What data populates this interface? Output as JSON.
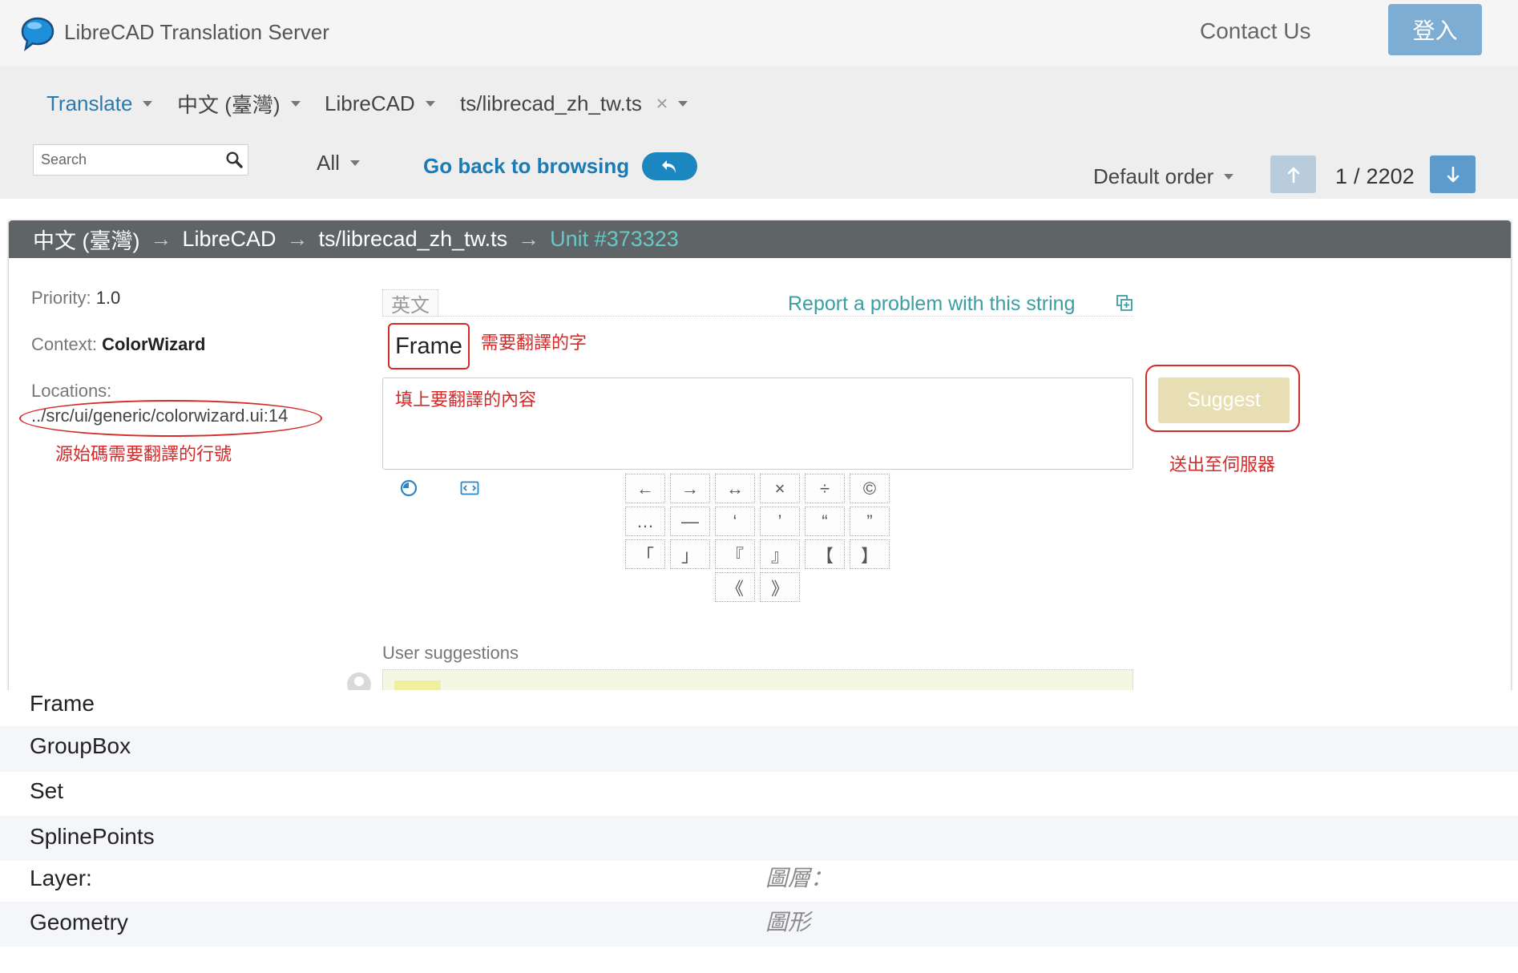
{
  "colors": {
    "brand_blue": "#1b7bb5",
    "header_bar": "#5f6566",
    "unit_teal": "#69c7c7",
    "report_teal": "#3b9ea2",
    "annotation_red": "#d42a2a",
    "suggest_button": "#e7dfb3",
    "login_button": "#7eadd3"
  },
  "header": {
    "logo_icon": "speech-bubble-icon",
    "title": "LibreCAD Translation Server",
    "contact": "Contact Us",
    "login": "登入"
  },
  "nav": {
    "breadcrumb": {
      "translate": "Translate",
      "language": "中文 (臺灣)",
      "project": "LibreCAD",
      "file": "ts/librecad_zh_tw.ts"
    },
    "search": {
      "placeholder": "Search"
    },
    "filter": "All",
    "go_back": "Go back to browsing",
    "order": "Default order",
    "pager": {
      "current": "1",
      "separator": "/",
      "total": "2202"
    }
  },
  "unit": {
    "path": [
      "中文 (臺灣)",
      "LibreCAD",
      "ts/librecad_zh_tw.ts",
      "Unit #373323"
    ],
    "path_separator": "→",
    "priority_label": "Priority:",
    "priority": "1.0",
    "context_label": "Context:",
    "context": "ColorWizard",
    "locations_label": "Locations:",
    "location": "../src/ui/generic/colorwizard.ui:14",
    "source_language": "英文",
    "report": "Report a problem with this string",
    "source": "Frame",
    "suggest": "Suggest",
    "special_chars": [
      "←",
      "→",
      "↔",
      "×",
      "÷",
      "©",
      "…",
      "—",
      "‘",
      "’",
      "“",
      "”",
      "「",
      "」",
      "『",
      "』",
      "【",
      "】",
      "《",
      "》"
    ],
    "user_suggestions_label": "User suggestions"
  },
  "annotations": {
    "source_word": "需要翻譯的字",
    "fill_in": "填上要翻譯的內容",
    "line_number": "源始碼需要翻譯的行號",
    "submit": "送出至伺服器"
  },
  "string_list": [
    {
      "source": "Frame",
      "target": ""
    },
    {
      "source": "GroupBox",
      "target": ""
    },
    {
      "source": "Set",
      "target": ""
    },
    {
      "source": "SplinePoints",
      "target": ""
    },
    {
      "source": "Layer:",
      "target": "圖層："
    },
    {
      "source": "Geometry",
      "target": "圖形"
    }
  ]
}
